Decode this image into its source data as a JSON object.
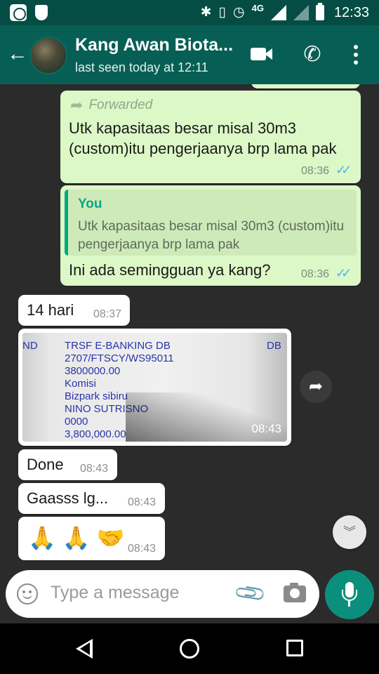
{
  "status_bar": {
    "network_type": "4G",
    "time": "12:33"
  },
  "header": {
    "contact_name": "Kang Awan Biota...",
    "last_seen": "last seen today at 12:11",
    "accent_color": "#075e54"
  },
  "messages": [
    {
      "direction": "outgoing",
      "forwarded_label": "Forwarded",
      "text": "Utk kapasitaas besar misal 30m3 (custom)itu pengerjaanya brp lama pak",
      "time": "08:36",
      "read": true
    },
    {
      "direction": "outgoing",
      "quote_author": "You",
      "quote_text": "Utk kapasitaas besar misal 30m3 (custom)itu pengerjaanya brp lama pak",
      "text": "Ini ada semingguan ya kang?",
      "time": "08:36",
      "read": true
    },
    {
      "direction": "incoming",
      "text": "14 hari",
      "time": "08:37"
    },
    {
      "direction": "incoming",
      "type": "image",
      "image_lines": [
        "TRSF E-BANKING DB",
        "2707/FTSCY/WS95011",
        "3800000.00",
        "Komisi",
        "Bizpark sibiru",
        "NINO SUTRISNO",
        "0000",
        "3,800,000.00"
      ],
      "image_left_fragment": "ND",
      "image_right_fragment": "DB",
      "time": "08:43"
    },
    {
      "direction": "incoming",
      "text": "Done",
      "time": "08:43"
    },
    {
      "direction": "incoming",
      "text": "Gaasss lg...",
      "time": "08:43"
    },
    {
      "direction": "incoming",
      "text": "🙏 🙏 🤝",
      "time": "08:43"
    }
  ],
  "composer": {
    "placeholder": "Type a message"
  },
  "icons": {
    "back": "arrow-left",
    "video_call": "video-camera",
    "voice_call": "phone",
    "menu": "more-vertical",
    "emoji": "smiley",
    "attach": "paperclip",
    "camera": "camera",
    "mic": "microphone",
    "share": "forward-arrow",
    "scroll_down": "double-chevron-down"
  },
  "colors": {
    "outgoing_bubble": "#dcf8c6",
    "incoming_bubble": "#ffffff",
    "read_ticks": "#4fb6ec",
    "mic_button": "#0b8f7c"
  }
}
